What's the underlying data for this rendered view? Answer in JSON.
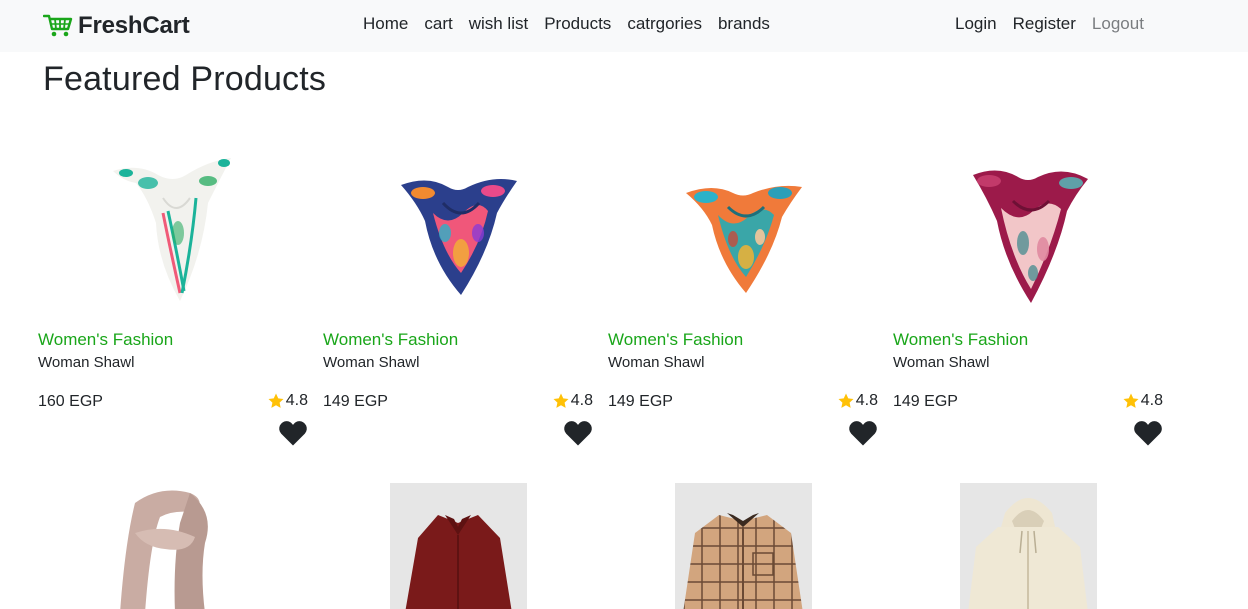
{
  "brand": {
    "name": "FreshCart",
    "icon": "cart-icon",
    "color": "#1aa61a"
  },
  "nav": {
    "center": [
      "Home",
      "cart",
      "wish list",
      "Products",
      "catrgories",
      "brands"
    ],
    "right": [
      "Login",
      "Register",
      "Logout"
    ]
  },
  "page_title": "Featured Products",
  "colors": {
    "accent_green": "#1aa61a",
    "star": "#ffc107",
    "heart": "#212529",
    "navbar_bg": "#f8f9fa"
  },
  "products": [
    {
      "category": "Women's Fashion",
      "title": "Woman Shawl",
      "price": "160 EGP",
      "rating": "4.8",
      "image": "scarf-teal-white"
    },
    {
      "category": "Women's Fashion",
      "title": "Woman Shawl",
      "price": "149 EGP",
      "rating": "4.8",
      "image": "scarf-blue-pink"
    },
    {
      "category": "Women's Fashion",
      "title": "Woman Shawl",
      "price": "149 EGP",
      "rating": "4.8",
      "image": "scarf-orange-teal"
    },
    {
      "category": "Women's Fashion",
      "title": "Woman Shawl",
      "price": "149 EGP",
      "rating": "4.8",
      "image": "scarf-magenta-pink"
    }
  ],
  "second_row": [
    {
      "image": "beige-wrap-scarf"
    },
    {
      "image": "burgundy-shirt"
    },
    {
      "image": "plaid-shirt"
    },
    {
      "image": "cream-hoodie"
    }
  ]
}
